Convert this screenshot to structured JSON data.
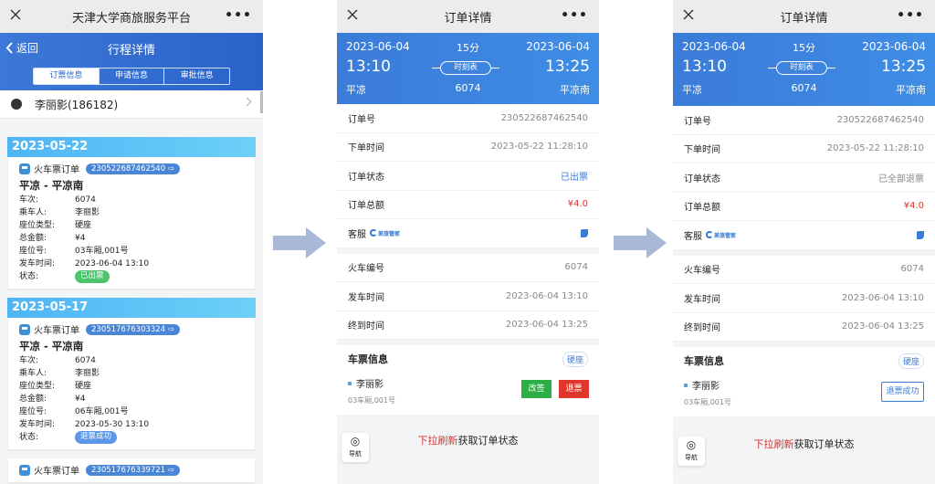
{
  "screen1": {
    "app_title": "天津大学商旅服务平台",
    "menu_dots": "•••",
    "back_label": "返回",
    "page_title": "行程详情",
    "tabs": [
      "订票信息",
      "申请信息",
      "审批信息"
    ],
    "passenger": "李丽影(186182)",
    "orders": [
      {
        "date": "2023-05-22",
        "type": "火车票订单",
        "order_no": "230522687462540",
        "route": "平凉 - 平凉南",
        "fields": [
          {
            "k": "车次:",
            "v": "6074"
          },
          {
            "k": "乘车人:",
            "v": "李丽影"
          },
          {
            "k": "座位类型:",
            "v": "硬座"
          },
          {
            "k": "总金额:",
            "v": "¥4"
          },
          {
            "k": "座位号:",
            "v": "03车厢,001号"
          },
          {
            "k": "发车时间:",
            "v": "2023-06-04 13:10"
          }
        ],
        "status_label": "状态:",
        "status": "已出票"
      },
      {
        "date": "2023-05-17",
        "type": "火车票订单",
        "order_no": "230517676303324",
        "route": "平凉 - 平凉南",
        "fields": [
          {
            "k": "车次:",
            "v": "6074"
          },
          {
            "k": "乘车人:",
            "v": "李丽影"
          },
          {
            "k": "座位类型:",
            "v": "硬座"
          },
          {
            "k": "总金额:",
            "v": "¥4"
          },
          {
            "k": "座位号:",
            "v": "06车厢,001号"
          },
          {
            "k": "发车时间:",
            "v": "2023-05-30 13:10"
          }
        ],
        "status_label": "状态:",
        "status": "退票成功"
      },
      {
        "type": "火车票订单",
        "order_no": "230517676339721"
      }
    ]
  },
  "screen2": {
    "title": "订单详情",
    "menu_dots": "•••",
    "trip": {
      "dep_date": "2023-06-04",
      "duration": "15分",
      "arr_date": "2023-06-04",
      "dep_time": "13:10",
      "schedule": "时刻表",
      "arr_time": "13:25",
      "from": "平凉",
      "train_no": "6074",
      "to": "平凉南"
    },
    "order_rows": [
      {
        "label": "订单号",
        "value": "230522687462540"
      },
      {
        "label": "下单时间",
        "value": "2023-05-22 11:28:10"
      },
      {
        "label": "订单状态",
        "value": "已出票"
      },
      {
        "label": "订单总额",
        "value": "¥4.0"
      }
    ],
    "service_label": "客服",
    "service_logo": "差旅管家",
    "train_rows": [
      {
        "label": "火车编号",
        "value": "6074"
      },
      {
        "label": "发车时间",
        "value": "2023-06-04 13:10"
      },
      {
        "label": "终到时间",
        "value": "2023-06-04 13:25"
      }
    ],
    "ticket_title": "车票信息",
    "seat_type": "硬座",
    "passenger": "李丽影",
    "seat": "03车厢,001号",
    "btn_change": "改签",
    "btn_refund": "退票",
    "refresh_red": "下拉刷新",
    "refresh_black": "获取订单状态",
    "nav_label": "导航"
  },
  "screen3": {
    "title": "订单详情",
    "menu_dots": "•••",
    "trip": {
      "dep_date": "2023-06-04",
      "duration": "15分",
      "arr_date": "2023-06-04",
      "dep_time": "13:10",
      "schedule": "时刻表",
      "arr_time": "13:25",
      "from": "平凉",
      "train_no": "6074",
      "to": "平凉南"
    },
    "order_rows": [
      {
        "label": "订单号",
        "value": "230522687462540"
      },
      {
        "label": "下单时间",
        "value": "2023-05-22 11:28:10"
      },
      {
        "label": "订单状态",
        "value": "已全部退票"
      },
      {
        "label": "订单总额",
        "value": "¥4.0"
      }
    ],
    "service_label": "客服",
    "service_logo": "差旅管家",
    "train_rows": [
      {
        "label": "火车编号",
        "value": "6074"
      },
      {
        "label": "发车时间",
        "value": "2023-06-04 13:10"
      },
      {
        "label": "终到时间",
        "value": "2023-06-04 13:25"
      }
    ],
    "ticket_title": "车票信息",
    "seat_type": "硬座",
    "passenger": "李丽影",
    "seat": "03车厢,001号",
    "btn_status": "退票成功",
    "refresh_red": "下拉刷新",
    "refresh_black": "获取订单状态",
    "nav_label": "导航"
  },
  "colors": {
    "primary": "#3b7bd8",
    "red": "#d8332f",
    "green": "#2dad46",
    "arrow": "#a9b8d6"
  }
}
